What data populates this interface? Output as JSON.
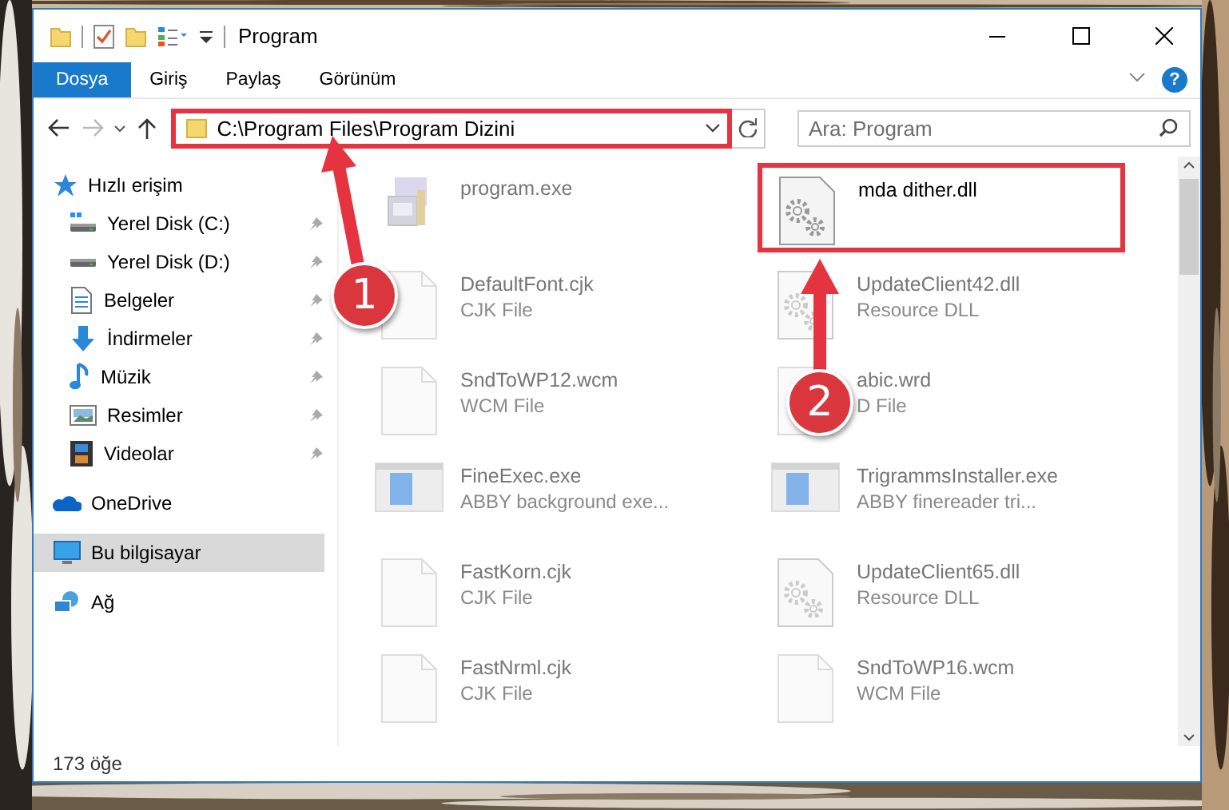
{
  "window": {
    "title": "Program"
  },
  "ribbon_tabs": [
    {
      "label": "Dosya",
      "selected": true
    },
    {
      "label": "Giriş",
      "selected": false
    },
    {
      "label": "Paylaş",
      "selected": false
    },
    {
      "label": "Görünüm",
      "selected": false
    }
  ],
  "help_button": "?",
  "address_bar": {
    "path": "C:\\Program Files\\Program Dizini",
    "highlighted": true
  },
  "search": {
    "placeholder": "Ara: Program"
  },
  "navigation": [
    {
      "label": "Hızlı erişim",
      "kind": "star",
      "selected": false,
      "children": [
        {
          "label": "Yerel Disk (C:)",
          "kind": "drive-c",
          "pinned": true,
          "selected": false
        },
        {
          "label": "Yerel Disk (D:)",
          "kind": "drive",
          "pinned": true,
          "selected": false
        },
        {
          "label": "Belgeler",
          "kind": "docs",
          "pinned": true,
          "selected": false
        },
        {
          "label": "İndirmeler",
          "kind": "download",
          "pinned": true,
          "selected": false
        },
        {
          "label": "Müzik",
          "kind": "music",
          "pinned": true,
          "selected": false
        },
        {
          "label": "Resimler",
          "kind": "pictures",
          "pinned": true,
          "selected": false
        },
        {
          "label": "Videolar",
          "kind": "video",
          "pinned": true,
          "selected": false
        }
      ]
    },
    {
      "label": "OneDrive",
      "kind": "cloud",
      "selected": false
    },
    {
      "label": "Bu bilgisayar",
      "kind": "pc",
      "selected": true
    },
    {
      "label": "Ağ",
      "kind": "network",
      "selected": false
    }
  ],
  "files": [
    {
      "name": "program.exe",
      "kind": "setup",
      "dimmed": true,
      "highlighted": false
    },
    {
      "name": "mda dither.dll",
      "kind": "dll",
      "dimmed": false,
      "highlighted": true
    },
    {
      "name": "DefaultFont.cjk",
      "type": "CJK File",
      "kind": "file",
      "dimmed": true,
      "highlighted": false
    },
    {
      "name": "UpdateClient42.dll",
      "type": "Resource DLL",
      "kind": "dll",
      "dimmed": true,
      "highlighted": false
    },
    {
      "name": "SndToWP12.wcm",
      "type": "WCM File",
      "kind": "file",
      "dimmed": true,
      "highlighted": false
    },
    {
      "name": "abic.wrd",
      "type": "D File",
      "kind": "file",
      "dimmed": true,
      "highlighted": false
    },
    {
      "name": "FineExec.exe",
      "type": "ABBY background exe...",
      "kind": "app",
      "dimmed": true,
      "highlighted": false
    },
    {
      "name": "TrigrammsInstaller.exe",
      "type": "ABBY finereader tri...",
      "kind": "app",
      "dimmed": true,
      "highlighted": false
    },
    {
      "name": "FastKorn.cjk",
      "type": "CJK File",
      "kind": "file",
      "dimmed": true,
      "highlighted": false
    },
    {
      "name": "UpdateClient65.dll",
      "type": "Resource DLL",
      "kind": "dll",
      "dimmed": true,
      "highlighted": false
    },
    {
      "name": "FastNrml.cjk",
      "type": "CJK File",
      "kind": "file",
      "dimmed": true,
      "highlighted": false
    },
    {
      "name": "SndToWP16.wcm",
      "type": "WCM File",
      "kind": "file",
      "dimmed": true,
      "highlighted": false
    }
  ],
  "status_bar": {
    "item_count": "173 öğe"
  },
  "callouts": [
    {
      "number": "1"
    },
    {
      "number": "2"
    }
  ]
}
